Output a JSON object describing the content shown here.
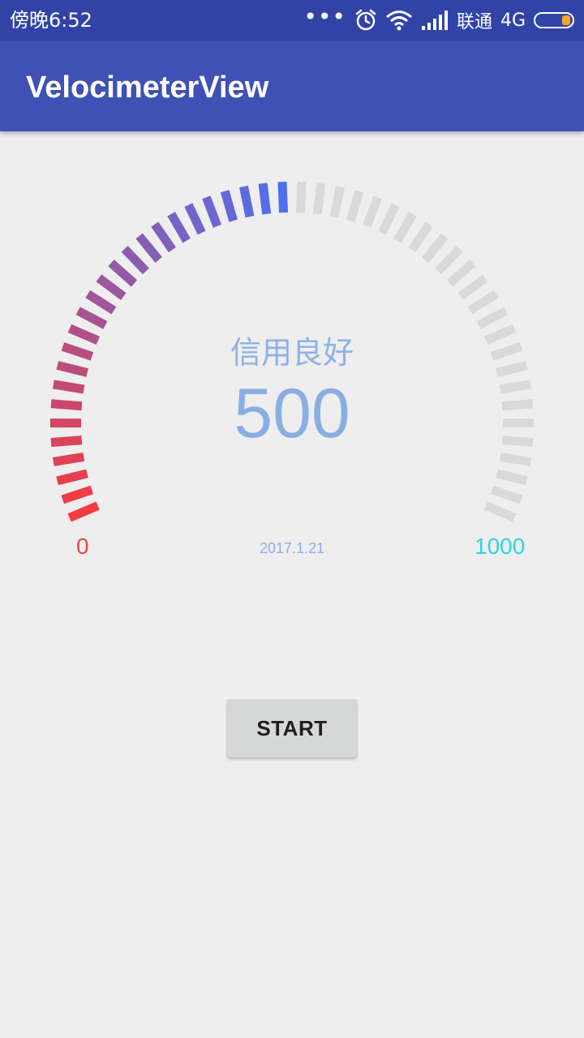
{
  "status_bar": {
    "time": "傍晚6:52",
    "icons": [
      "more-dots-icon",
      "alarm-icon",
      "wifi-icon",
      "signal-icon",
      "battery-icon"
    ],
    "dots": "•••",
    "carrier": "联通",
    "network": "4G"
  },
  "app_bar": {
    "title": "VelocimeterView"
  },
  "gauge": {
    "status_text": "信用良好",
    "value": "500",
    "value_num": 500,
    "min_label": "0",
    "max_label": "1000",
    "min": 0,
    "max": 1000,
    "date": "2017.1.21",
    "colors": {
      "start": "#f53a41",
      "end": "#4e6ff0",
      "inactive": "#d9d9d9",
      "label": "#8aaee3",
      "min_label": "#f2444a",
      "max_label": "#2bd6e8"
    }
  },
  "button": {
    "label": "START"
  }
}
